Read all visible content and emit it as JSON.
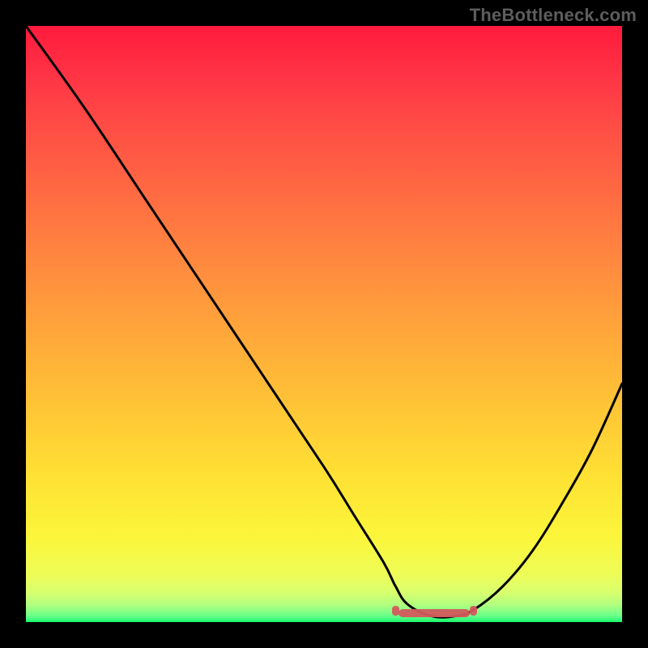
{
  "watermark": "TheBottleneck.com",
  "chart_data": {
    "type": "line",
    "title": "",
    "xlabel": "",
    "ylabel": "",
    "xlim": [
      0,
      100
    ],
    "ylim": [
      0,
      100
    ],
    "x": [
      0,
      10,
      20,
      30,
      40,
      50,
      55,
      60,
      62,
      64,
      68,
      72,
      75,
      80,
      85,
      90,
      95,
      100
    ],
    "values": [
      100,
      86,
      71,
      56,
      41,
      26,
      18,
      10,
      6,
      3,
      1,
      1,
      2,
      6,
      12,
      20,
      29,
      40
    ],
    "curve_color": "#000000",
    "flat_segment": {
      "x_start": 62,
      "x_end": 75,
      "y": 1.5,
      "color": "#d35a5d"
    },
    "gradient_stops": [
      {
        "pct": 0,
        "color": "#ff1a3c"
      },
      {
        "pct": 18,
        "color": "#ff5045"
      },
      {
        "pct": 40,
        "color": "#ff8a3f"
      },
      {
        "pct": 64,
        "color": "#ffc536"
      },
      {
        "pct": 86,
        "color": "#fbf63b"
      },
      {
        "pct": 97,
        "color": "#b4ff7e"
      },
      {
        "pct": 100,
        "color": "#16f76b"
      }
    ],
    "grid": false,
    "legend": false
  }
}
